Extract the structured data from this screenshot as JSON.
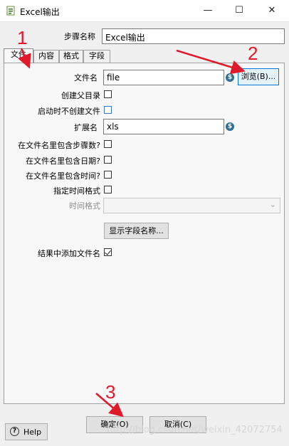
{
  "window": {
    "title": "Excel输出",
    "min_glyph": "—",
    "max_glyph": "☐",
    "close_glyph": "✕"
  },
  "step_name": {
    "label": "步骤名称",
    "value": "Excel输出"
  },
  "tabs": [
    {
      "label": "文件",
      "active": true
    },
    {
      "label": "内容",
      "active": false
    },
    {
      "label": "格式",
      "active": false
    },
    {
      "label": "字段",
      "active": false
    }
  ],
  "file_tab": {
    "filename": {
      "label": "文件名",
      "value": "file",
      "var_icon": "$"
    },
    "browse_label": "浏览(B)...",
    "create_parent_folder": {
      "label": "创建父目录",
      "checked": false
    },
    "do_not_create_at_start": {
      "label": "启动时不创建文件",
      "checked": false
    },
    "extension": {
      "label": "扩展名",
      "value": "xls",
      "var_icon": "$"
    },
    "include_step_nr": {
      "label": "在文件名里包含步骤数?",
      "checked": false
    },
    "include_date": {
      "label": "在文件名里包含日期?",
      "checked": false
    },
    "include_time": {
      "label": "在文件名里包含时间?",
      "checked": false
    },
    "specify_time_format": {
      "label": "指定时间格式",
      "checked": false
    },
    "time_format": {
      "label": "时间格式",
      "value": ""
    },
    "show_fields_label": "显示字段名称...",
    "add_to_result": {
      "label": "结果中添加文件名",
      "checked": true
    }
  },
  "footer": {
    "ok_label": "确定(O)",
    "cancel_label": "取消(C)",
    "help_label": "Help",
    "help_glyph": "?"
  },
  "annotations": {
    "one": "1",
    "two": "2",
    "three": "3",
    "color": "#e0192b"
  },
  "watermark": "http://blog.csdn.net/weixin_42072754"
}
